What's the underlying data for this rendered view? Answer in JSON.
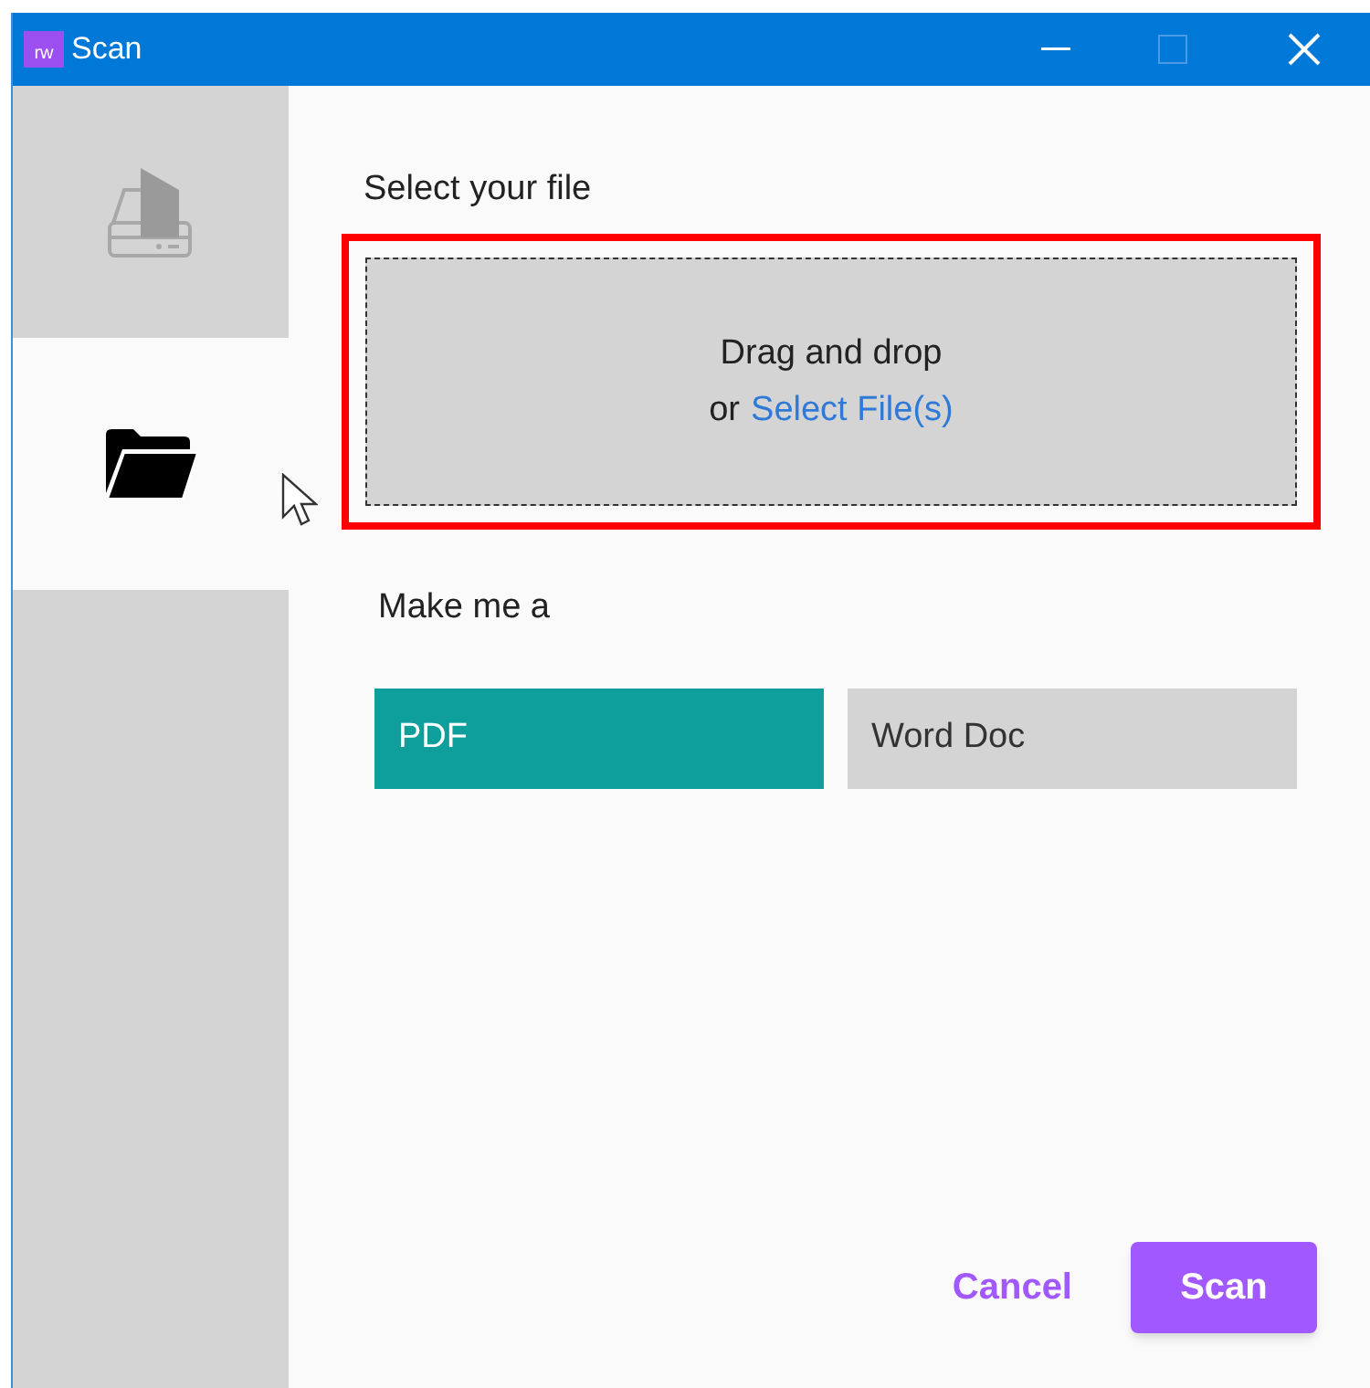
{
  "window": {
    "title": "Scan",
    "logo": "rw"
  },
  "sidebar": {
    "items": [
      {
        "kind": "scanner",
        "selected": false
      },
      {
        "kind": "folder",
        "selected": true
      }
    ]
  },
  "file_section": {
    "label": "Select your file",
    "drop_zone": {
      "text": "Drag and drop",
      "prefix": "or",
      "link": "Select File(s)",
      "highlighted": true
    }
  },
  "output": {
    "label": "Make me a",
    "options": [
      {
        "label": "PDF",
        "selected": true
      },
      {
        "label": "Word Doc",
        "selected": false
      }
    ]
  },
  "buttons": [
    {
      "label": "Cancel",
      "kind": "text"
    },
    {
      "label": "Scan",
      "kind": "primary"
    }
  ]
}
